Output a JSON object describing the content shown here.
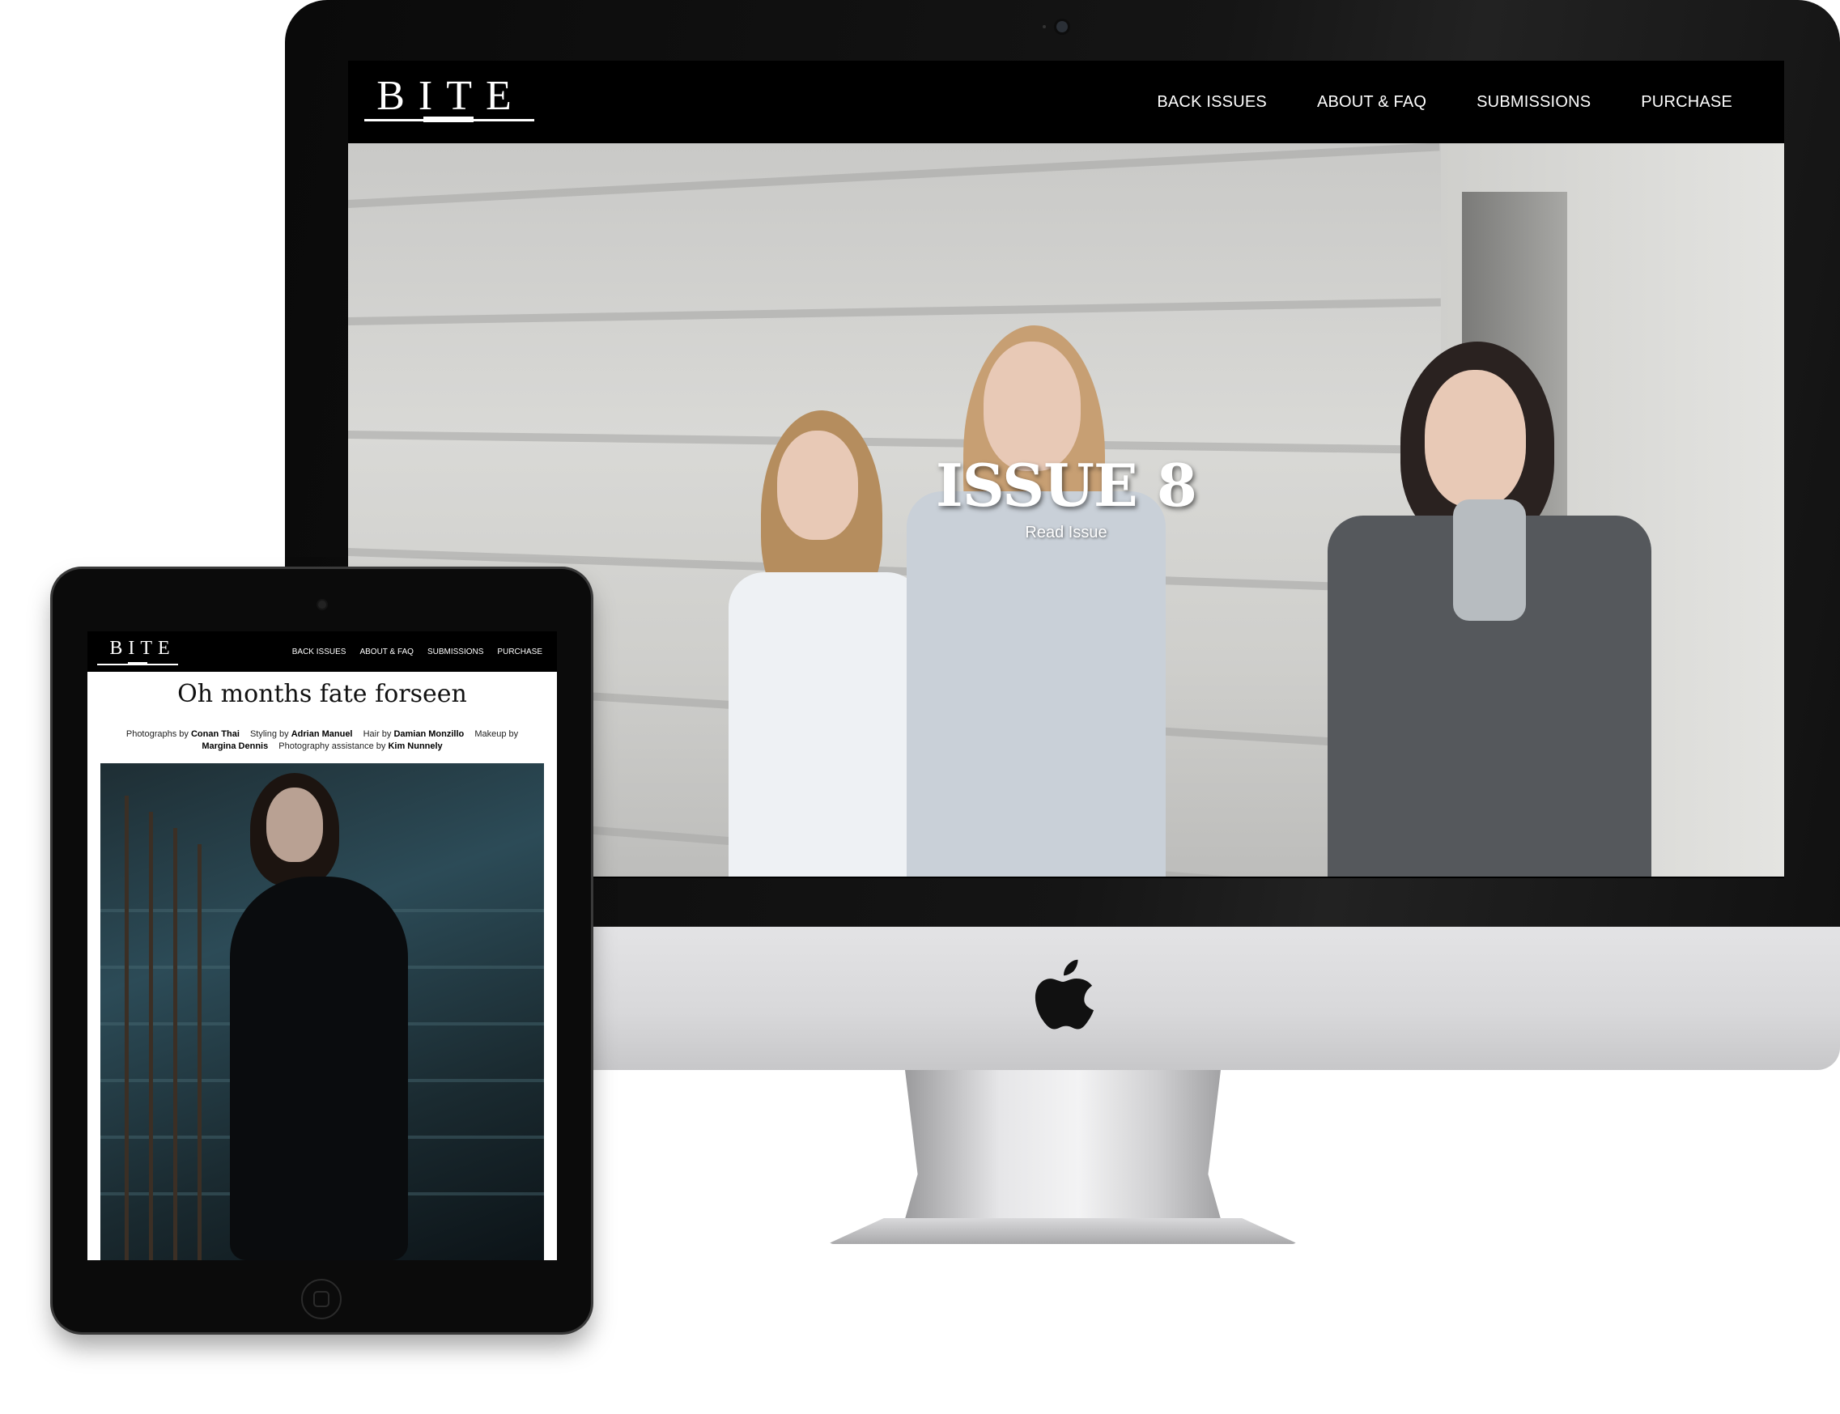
{
  "desktop": {
    "logo": "BITE",
    "nav": [
      "BACK ISSUES",
      "ABOUT & FAQ",
      "SUBMISSIONS",
      "PURCHASE"
    ],
    "hero": {
      "title": "ISSUE 8",
      "link": "Read Issue"
    }
  },
  "tablet": {
    "logo": "BITE",
    "nav": [
      "BACK ISSUES",
      "ABOUT & FAQ",
      "SUBMISSIONS",
      "PURCHASE"
    ],
    "article": {
      "title": "Oh months fate forseen",
      "credits": {
        "photographs_label": "Photographs by",
        "photographs_name": "Conan Thai",
        "styling_label": "Styling by",
        "styling_name": "Adrian Manuel",
        "hair_label": "Hair by",
        "hair_name": "Damian Monzillo",
        "makeup_label": "Makeup by",
        "makeup_name": "Margina Dennis",
        "assistance_label": "Photography assistance by",
        "assistance_name": "Kim Nunnely"
      }
    }
  },
  "colors": {
    "header_bg": "#000000",
    "nav_text": "#ffffff",
    "page_bg": "#ffffff"
  },
  "icons": [
    "apple-logo-icon",
    "camera-icon",
    "home-button-icon"
  ]
}
